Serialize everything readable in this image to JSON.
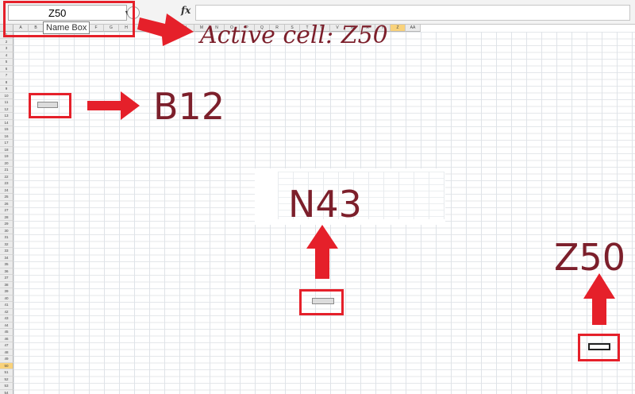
{
  "formula_bar": {
    "name_box_value": "Z50",
    "fx_label": "fx",
    "formula_value": ""
  },
  "tooltip": "Name Box",
  "columns": [
    "A",
    "B",
    "C",
    "D",
    "E",
    "F",
    "G",
    "H",
    "I",
    "J",
    "K",
    "L",
    "M",
    "N",
    "O",
    "P",
    "Q",
    "R",
    "S",
    "T",
    "U",
    "V",
    "W",
    "X",
    "Y",
    "Z",
    "AA"
  ],
  "active_column": "Z",
  "rows_visible": 55,
  "active_row": "50",
  "annotations": {
    "active_cell_text": "Active cell: Z50",
    "b12_text": "B12",
    "n43_text": "N43",
    "z50_text": "Z50"
  },
  "colors": {
    "highlight": "#e5202a",
    "callout_text": "#7c1f2b",
    "active_header": "#f9d27a"
  }
}
